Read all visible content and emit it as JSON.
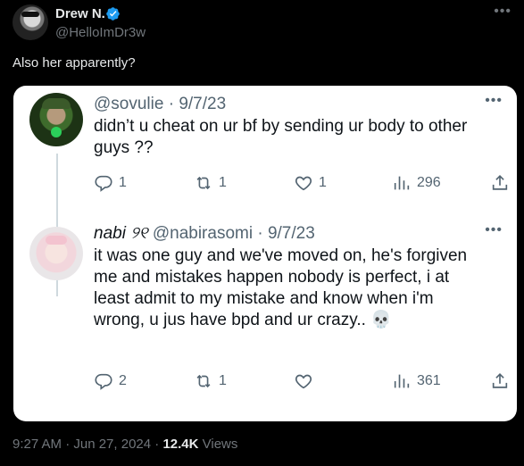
{
  "post": {
    "author_name": "Drew N.",
    "author_handle": "@HelloImDr3w",
    "text": "Also her apparently?",
    "more": "•••",
    "timestamp": "9:27 AM · Jun 27, 2024 · ",
    "views_count": "12.4K",
    "views_label": " Views"
  },
  "embedded": {
    "replies": [
      {
        "display_name": "",
        "handle": "@sovulie",
        "date": "· 9/7/23",
        "text": "didn’t u cheat on ur bf by sending ur body to other guys ??",
        "more": "•••",
        "stats": {
          "replies": "1",
          "reposts": "1",
          "likes": "1",
          "views": "296"
        }
      },
      {
        "display_name": "nabi ୨୧",
        "handle": "@nabirasomi",
        "date": "· 9/7/23",
        "text": "it was one guy and we've moved on, he's forgiven me and mistakes happen nobody is perfect, i at least admit to my mistake and know when i'm wrong, u jus have bpd and ur crazy.. 💀",
        "more": "•••",
        "stats": {
          "replies": "2",
          "reposts": "1",
          "likes": "",
          "views": "361"
        }
      }
    ]
  },
  "colors": {
    "verified": "#1d9bf0",
    "background": "#000000",
    "card": "#ffffff"
  },
  "icons": [
    "verified-badge-icon",
    "reply-icon",
    "repost-icon",
    "like-icon",
    "views-icon",
    "share-icon",
    "more-icon"
  ]
}
